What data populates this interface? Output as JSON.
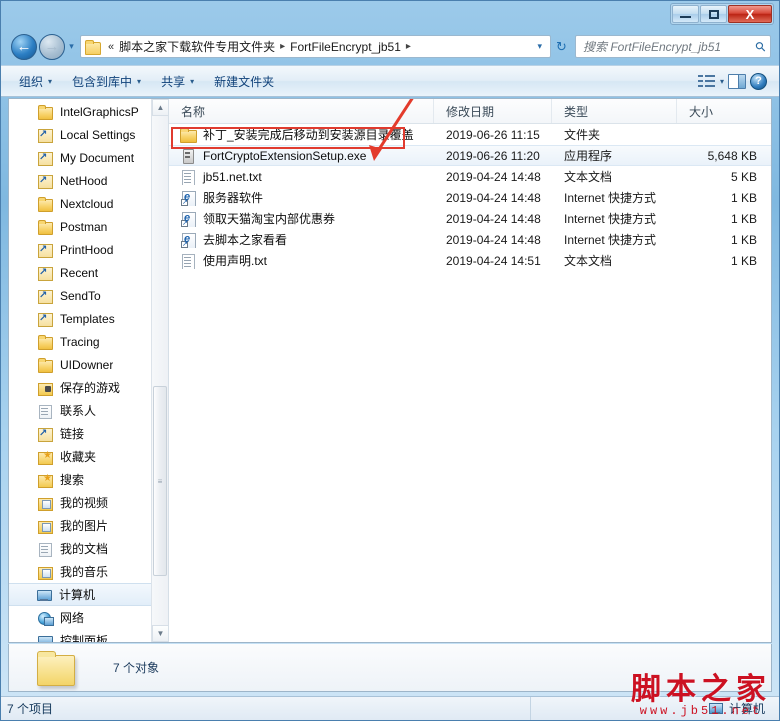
{
  "window": {
    "minimize_label": "最小化",
    "restore_label": "还原",
    "close_label": "X"
  },
  "nav": {
    "back_icon": "←",
    "forward_icon": "→",
    "history_caret": "▾",
    "refresh_icon": "↻",
    "address_dropdown": "▾",
    "breadcrumb": {
      "overflow": "«",
      "items": [
        {
          "label": "脚本之家下载软件专用文件夹",
          "sep": "▸"
        },
        {
          "label": "FortFileEncrypt_jb51",
          "sep": "▸"
        }
      ]
    },
    "search": {
      "placeholder": "搜索 FortFileEncrypt_jb51",
      "icon": "search-icon"
    }
  },
  "toolbar": {
    "items": [
      {
        "label": "组织",
        "caret": "▾"
      },
      {
        "label": "包含到库中",
        "caret": "▾"
      },
      {
        "label": "共享",
        "caret": "▾"
      },
      {
        "label": "新建文件夹",
        "caret": ""
      }
    ],
    "view_caret": "▾",
    "help_glyph": "?"
  },
  "sidebar": {
    "items": [
      {
        "label": "IntelGraphicsP",
        "icon": "folder"
      },
      {
        "label": "Local Settings",
        "icon": "shortcut"
      },
      {
        "label": "My Document",
        "icon": "shortcut"
      },
      {
        "label": "NetHood",
        "icon": "shortcut"
      },
      {
        "label": "Nextcloud",
        "icon": "folder"
      },
      {
        "label": "Postman",
        "icon": "folder"
      },
      {
        "label": "PrintHood",
        "icon": "shortcut"
      },
      {
        "label": "Recent",
        "icon": "shortcut"
      },
      {
        "label": "SendTo",
        "icon": "shortcut"
      },
      {
        "label": "Templates",
        "icon": "shortcut"
      },
      {
        "label": "Tracing",
        "icon": "folder"
      },
      {
        "label": "UIDowner",
        "icon": "folder"
      },
      {
        "label": "保存的游戏",
        "icon": "games"
      },
      {
        "label": "联系人",
        "icon": "doc"
      },
      {
        "label": "链接",
        "icon": "shortcut"
      },
      {
        "label": "收藏夹",
        "icon": "star"
      },
      {
        "label": "搜索",
        "icon": "star"
      },
      {
        "label": "我的视频",
        "icon": "media"
      },
      {
        "label": "我的图片",
        "icon": "media"
      },
      {
        "label": "我的文档",
        "icon": "doc"
      },
      {
        "label": "我的音乐",
        "icon": "media"
      },
      {
        "label": "计算机",
        "icon": "pc",
        "selected": true
      },
      {
        "label": "网络",
        "icon": "net"
      },
      {
        "label": "控制面板",
        "icon": "pc"
      }
    ],
    "scroll_up": "▲",
    "scroll_down": "▼",
    "thumb_grip": "≡"
  },
  "filelist": {
    "columns": [
      {
        "key": "name",
        "label": "名称"
      },
      {
        "key": "date",
        "label": "修改日期"
      },
      {
        "key": "type",
        "label": "类型"
      },
      {
        "key": "size",
        "label": "大小"
      }
    ],
    "rows": [
      {
        "name": "补丁_安装完成后移动到安装源目录覆盖",
        "date": "2019-06-26 11:15",
        "type": "文件夹",
        "size": "",
        "icon": "folder",
        "selected": false
      },
      {
        "name": "FortCryptoExtensionSetup.exe",
        "date": "2019-06-26 11:20",
        "type": "应用程序",
        "size": "5,648 KB",
        "icon": "exe",
        "selected": true
      },
      {
        "name": "jb51.net.txt",
        "date": "2019-04-24 14:48",
        "type": "文本文档",
        "size": "5 KB",
        "icon": "txt",
        "selected": false
      },
      {
        "name": "服务器软件",
        "date": "2019-04-24 14:48",
        "type": "Internet 快捷方式",
        "size": "1 KB",
        "icon": "url",
        "selected": false
      },
      {
        "name": "领取天猫淘宝内部优惠券",
        "date": "2019-04-24 14:48",
        "type": "Internet 快捷方式",
        "size": "1 KB",
        "icon": "url",
        "selected": false
      },
      {
        "name": "去脚本之家看看",
        "date": "2019-04-24 14:48",
        "type": "Internet 快捷方式",
        "size": "1 KB",
        "icon": "url",
        "selected": false
      },
      {
        "name": "使用声明.txt",
        "date": "2019-04-24 14:51",
        "type": "文本文档",
        "size": "1 KB",
        "icon": "txt",
        "selected": false
      }
    ]
  },
  "details_pane": {
    "text": "7 个对象"
  },
  "statusbar": {
    "left": "7 个项目",
    "right": "计算机"
  },
  "annotation": {
    "color": "#e03b2f",
    "rect_target": "FortCryptoExtensionSetup.exe",
    "arrow": "pointer-to-exe-row"
  },
  "watermark": {
    "main": "脚本之家",
    "sub": "www.jb51.net",
    "color": "#cc1122"
  }
}
